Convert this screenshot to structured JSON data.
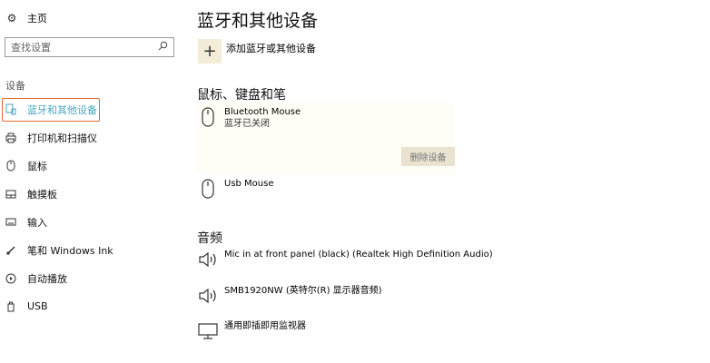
{
  "sidebar": {
    "home_label": "主页",
    "search_placeholder": "查找设置",
    "section_label": "设备",
    "items": [
      {
        "label": "蓝牙和其他设备",
        "icon": "bluetooth-devices-icon",
        "active": true
      },
      {
        "label": "打印机和扫描仪",
        "icon": "printer-icon",
        "active": false
      },
      {
        "label": "鼠标",
        "icon": "mouse-icon",
        "active": false
      },
      {
        "label": "触摸板",
        "icon": "touchpad-icon",
        "active": false
      },
      {
        "label": "输入",
        "icon": "keyboard-icon",
        "active": false
      },
      {
        "label": "笔和 Windows Ink",
        "icon": "pen-icon",
        "active": false
      },
      {
        "label": "自动播放",
        "icon": "autoplay-icon",
        "active": false
      },
      {
        "label": "USB",
        "icon": "usb-icon",
        "active": false
      }
    ]
  },
  "main": {
    "title": "蓝牙和其他设备",
    "add_label": "添加蓝牙或其他设备",
    "mouse_section": {
      "title": "鼠标、键盘和笔",
      "devices": [
        {
          "name": "Bluetooth  Mouse",
          "status": "蓝牙已关闭"
        },
        {
          "name": "Usb Mouse",
          "status": ""
        }
      ],
      "remove_label": "删除设备"
    },
    "audio_section": {
      "title": "音频",
      "devices": [
        {
          "name": "Mic in at front panel (black) (Realtek High Definition Audio)"
        },
        {
          "name": "SMB1920NW (英特尔(R) 显示器音频)"
        },
        {
          "name": "通用即插即用监视器"
        }
      ]
    }
  },
  "colors": {
    "accent": "#4aa6c2",
    "highlight_border": "#e46a33",
    "add_button_bg": "#f3ecd6",
    "remove_button_bg": "#e8e2cf"
  }
}
